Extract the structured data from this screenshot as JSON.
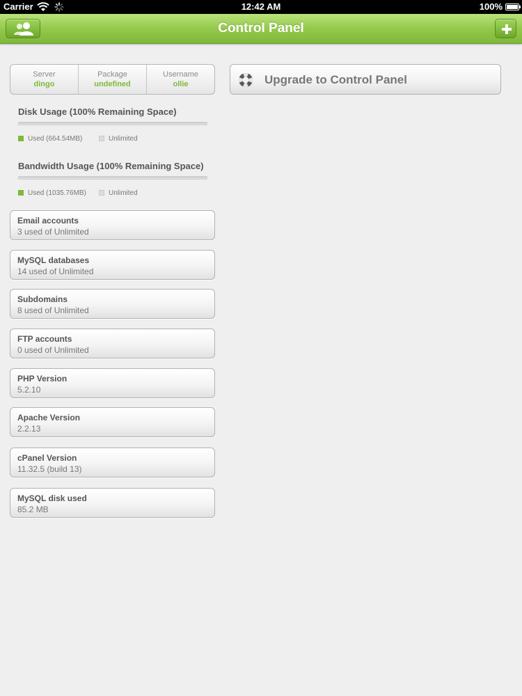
{
  "status_bar": {
    "carrier": "Carrier",
    "time": "12:42 AM",
    "battery": "100%"
  },
  "nav": {
    "title": "Control Panel",
    "left_icon": "users-icon",
    "right_icon": "plus-icon"
  },
  "stats": [
    {
      "label": "Server",
      "value": "dingo"
    },
    {
      "label": "Package",
      "value": "undefined"
    },
    {
      "label": "Username",
      "value": "ollie"
    }
  ],
  "disk": {
    "title": "Disk Usage (100% Remaining Space)",
    "used_label": "Used (664.54MB)",
    "unlimited_label": "Unlimited",
    "used_fraction": 0
  },
  "bandwidth": {
    "title": "Bandwidth Usage (100% Remaining Space)",
    "used_label": "Used (1035.76MB)",
    "unlimited_label": "Unlimited",
    "used_fraction": 0
  },
  "cards": [
    {
      "title": "Email accounts",
      "subtitle": "3 used of Unlimited"
    },
    {
      "title": "MySQL databases",
      "subtitle": "14 used of Unlimited"
    },
    {
      "title": "Subdomains",
      "subtitle": "8 used of Unlimited"
    },
    {
      "title": "FTP accounts",
      "subtitle": "0 used of Unlimited"
    },
    {
      "title": "PHP Version",
      "subtitle": "5.2.10"
    },
    {
      "title": "Apache Version",
      "subtitle": "2.2.13"
    },
    {
      "title": "cPanel Version",
      "subtitle": "11.32.5 (build 13)"
    },
    {
      "title": "MySQL disk used",
      "subtitle": "85.2 MB"
    }
  ],
  "upgrade": {
    "label": "Upgrade to Control Panel",
    "icon": "lifebuoy-icon"
  },
  "colors": {
    "accent": "#7fb83a",
    "background": "#efefef"
  }
}
